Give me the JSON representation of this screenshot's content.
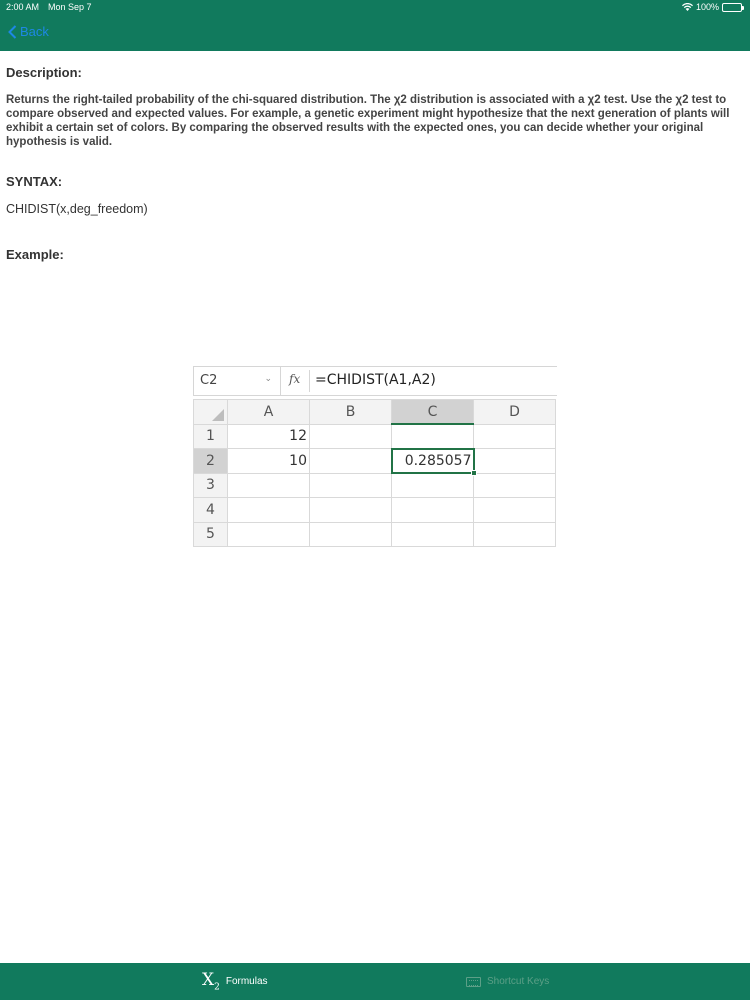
{
  "status_bar": {
    "time": "2:00 AM",
    "date": "Mon Sep 7",
    "battery": "100%"
  },
  "nav": {
    "back_label": "Back"
  },
  "description": {
    "title": "Description:",
    "body": "Returns the right-tailed probability of the chi-squared distribution. The χ2 distribution is associated with a χ2 test. Use the χ2 test to compare observed and expected values. For example, a genetic experiment might hypothesize that the next generation of plants will exhibit a certain set of colors. By comparing the observed results with the expected ones, you can decide whether your original hypothesis is valid."
  },
  "syntax": {
    "title": "SYNTAX:",
    "body": "CHIDIST(x,deg_freedom)"
  },
  "example": {
    "title": "Example:",
    "name_box": "C2",
    "fx_label": "fx",
    "formula": "=CHIDIST(A1,A2)",
    "columns": [
      "A",
      "B",
      "C",
      "D"
    ],
    "rows": [
      {
        "num": "1",
        "cells": [
          "12",
          "",
          "",
          ""
        ]
      },
      {
        "num": "2",
        "cells": [
          "10",
          "",
          "0.285057",
          ""
        ]
      },
      {
        "num": "3",
        "cells": [
          "",
          "",
          "",
          ""
        ]
      },
      {
        "num": "4",
        "cells": [
          "",
          "",
          "",
          ""
        ]
      },
      {
        "num": "5",
        "cells": [
          "",
          "",
          "",
          ""
        ]
      }
    ]
  },
  "tabs": [
    {
      "label": "Formulas",
      "icon": "x2-formulas-icon",
      "active": true
    },
    {
      "label": "Shortcut Keys",
      "icon": "keyboard-icon",
      "active": false
    }
  ],
  "colors": {
    "bar": "#117a5d",
    "link": "#1e88e5",
    "excel_green": "#217346"
  }
}
